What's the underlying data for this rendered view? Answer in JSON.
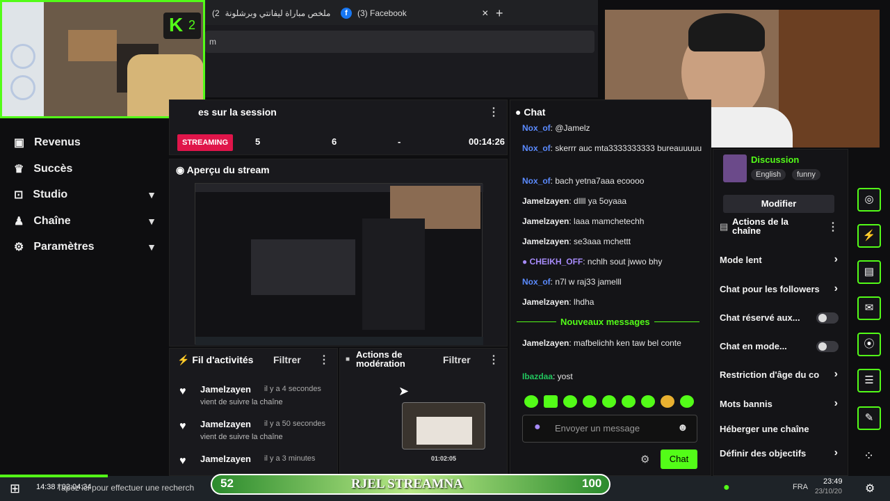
{
  "browser": {
    "tab1": "ملخص مباراة ليفانتي وبرشلونة",
    "tab1_prefix": "(2",
    "tab2": "(3) Facebook",
    "address_fragment": "m"
  },
  "brand": {
    "kick_badge": "K",
    "kick_count": "2"
  },
  "sidebar": {
    "items": [
      {
        "label": "Revenus"
      },
      {
        "label": "Succès"
      },
      {
        "label": "Studio"
      },
      {
        "label": "Chaîne"
      },
      {
        "label": "Paramètres"
      }
    ]
  },
  "session": {
    "title": "es sur la session",
    "badge": "STREAMING",
    "stats": [
      "5",
      "6",
      "-",
      "00:14:26"
    ]
  },
  "preview": {
    "title": "Aperçu du stream"
  },
  "activity": {
    "title": "Fil d'activités",
    "filter": "Filtrer",
    "rows": [
      {
        "name": "Jamelzayen",
        "time": "il y a 4 secondes",
        "desc": "vient de suivre la chaîne"
      },
      {
        "name": "Jamelzayen",
        "time": "il y a 50 secondes",
        "desc": "vient de suivre la chaîne"
      },
      {
        "name": "Jamelzayen",
        "time": "il y a 3 minutes",
        "desc": ""
      }
    ]
  },
  "moderation": {
    "title": "Actions de modération",
    "filter": "Filtrer",
    "clip_time": "01:02:05"
  },
  "chat": {
    "title": "Chat",
    "messages": [
      {
        "user": "Nox_of",
        "text": ": @Jamelz",
        "color": "blue"
      },
      {
        "user": "Nox_of",
        "text": ": skerrr auc mta3333333333 bureauuuuu",
        "color": "blue"
      },
      {
        "user": "Nox_of",
        "text": ": bach yetna7aaa ecoooo",
        "color": "blue"
      },
      {
        "user": "Jamelzayen",
        "text": ": dllll ya 5oyaaa",
        "color": "white"
      },
      {
        "user": "Jamelzayen",
        "text": ": laaa mamchetechh",
        "color": "white"
      },
      {
        "user": "Jamelzayen",
        "text": ": se3aaa mchettt",
        "color": "white"
      },
      {
        "user": "CHEIKH_OFF",
        "text": ": nchlh sout jwwo bhy",
        "color": "purple"
      },
      {
        "user": "Nox_of",
        "text": ": n7l w raj33 jamelll",
        "color": "blue"
      },
      {
        "user": "Jamelzayen",
        "text": ": lhdha",
        "color": "white"
      }
    ],
    "new_messages": "Nouveaux messages",
    "new": [
      {
        "user": "Jamelzayen",
        "text": ": mafbelichh ken taw bel conte",
        "color": "white"
      },
      {
        "user": "Ibazdaa",
        "text": ": yost",
        "color": "green"
      }
    ],
    "input_placeholder": "Envoyer un message",
    "send_label": "Chat"
  },
  "channel": {
    "category": "Discussion",
    "tags": [
      "English",
      "funny"
    ],
    "modify": "Modifier",
    "actions_title": "Actions de la chaîne",
    "actions": [
      {
        "label": "Mode lent",
        "kind": "arrow"
      },
      {
        "label": "Chat pour les followers",
        "kind": "arrow"
      },
      {
        "label": "Chat réservé aux...",
        "kind": "toggle"
      },
      {
        "label": "Chat en mode...",
        "kind": "toggle"
      },
      {
        "label": "Restriction d'âge du co",
        "kind": "arrow"
      },
      {
        "label": "Mots bannis",
        "kind": "arrow"
      },
      {
        "label": "Héberger une chaîne",
        "kind": "none"
      },
      {
        "label": "Définir des objectifs",
        "kind": "arrow"
      }
    ]
  },
  "overlay": {
    "left_value": "52",
    "title": "RJEL STREAMNA",
    "right_value": "100",
    "progress": 0.12
  },
  "taskbar": {
    "timer": "14:38 / 02:04:34",
    "search": "Tapez ici pour effectuer une recherch",
    "lang": "FRA",
    "clock": "23:49",
    "date": "23/10/20"
  },
  "colors": {
    "kick_green": "#53fc18",
    "streaming_red": "#e0154a"
  }
}
